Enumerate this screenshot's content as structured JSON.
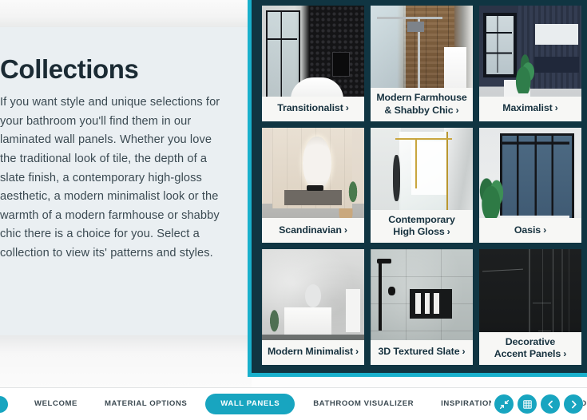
{
  "left_panel": {
    "title": "Collections",
    "description": "If you want style and unique selections for your bathroom you'll find them in our laminated wall panels. Whether you love the traditional look of tile, the depth of a slate finish, a contemporary high-gloss aesthetic, a modern minimalist look or the warmth of a modern farmhouse or shabby chic there is a choice for you. Select a collection to view its' patterns and styles."
  },
  "collections": {
    "chevron": "›",
    "cards": [
      {
        "id": "transitionalist",
        "label": "Transitionalist",
        "lines": [
          "Transitionalist"
        ]
      },
      {
        "id": "modern-farmhouse",
        "label": "Modern Farmhouse & Shabby Chic",
        "lines": [
          "Modern Farmhouse",
          "& Shabby Chic"
        ]
      },
      {
        "id": "maximalist",
        "label": "Maximalist",
        "lines": [
          "Maximalist"
        ]
      },
      {
        "id": "scandinavian",
        "label": "Scandinavian",
        "lines": [
          "Scandinavian"
        ]
      },
      {
        "id": "contemporary-high-gloss",
        "label": "Contemporary High Gloss",
        "lines": [
          "Contemporary",
          "High Gloss"
        ]
      },
      {
        "id": "oasis",
        "label": "Oasis",
        "lines": [
          "Oasis"
        ]
      },
      {
        "id": "modern-minimalist",
        "label": "Modern Minimalist",
        "lines": [
          "Modern Minimalist"
        ]
      },
      {
        "id": "3d-textured-slate",
        "label": "3D Textured Slate",
        "lines": [
          "3D Textured Slate"
        ]
      },
      {
        "id": "decorative-accent",
        "label": "Decorative Accent Panels",
        "lines": [
          "Decorative",
          "Accent Panels"
        ]
      }
    ]
  },
  "navbar": {
    "items": [
      {
        "label": "WELCOME",
        "active": false
      },
      {
        "label": "MATERIAL OPTIONS",
        "active": false
      },
      {
        "label": "WALL PANELS",
        "active": true
      },
      {
        "label": "BATHROOM VISUALIZER",
        "active": false
      },
      {
        "label": "INSPIRATION GALLERY",
        "active": false
      },
      {
        "label": "BEFOR",
        "active": false
      }
    ],
    "icons": [
      {
        "name": "collapse-icon",
        "glyph": "collapse"
      },
      {
        "name": "grid-icon",
        "glyph": "grid"
      },
      {
        "name": "prev-icon",
        "glyph": "chevron-left"
      },
      {
        "name": "next-icon",
        "glyph": "chevron-right"
      }
    ]
  },
  "colors": {
    "panel_dark": "#103542",
    "accent_cyan": "#19b0cc",
    "nav_teal": "#18a5c0",
    "left_panel_bg": "#eaeff2",
    "card_label_bg": "#f7f7f5",
    "text_dark": "#17323f"
  }
}
